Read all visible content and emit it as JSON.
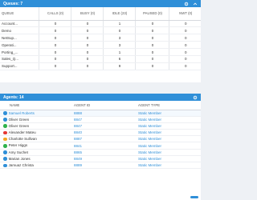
{
  "queues": {
    "title": "Queues: 7",
    "columns": [
      "QUEUE",
      "CALLS (0)",
      "BUSY (0)",
      "IDLE (23)",
      "PAUSED (0)",
      "NWT (0)"
    ],
    "rows": [
      {
        "name": "Account...",
        "calls": "0",
        "busy": "0",
        "idle": "1",
        "paused": "0",
        "nwt": "0"
      },
      {
        "name": "Demo",
        "calls": "0",
        "busy": "0",
        "idle": "0",
        "paused": "0",
        "nwt": "0"
      },
      {
        "name": "NetSup...",
        "calls": "0",
        "busy": "0",
        "idle": "3",
        "paused": "0",
        "nwt": "0"
      },
      {
        "name": "Operati...",
        "calls": "0",
        "busy": "0",
        "idle": "3",
        "paused": "0",
        "nwt": "0"
      },
      {
        "name": "Porting_...",
        "calls": "0",
        "busy": "0",
        "idle": "1",
        "paused": "0",
        "nwt": "0"
      },
      {
        "name": "Sales_Q...",
        "calls": "0",
        "busy": "0",
        "idle": "6",
        "paused": "0",
        "nwt": "0"
      },
      {
        "name": "Support...",
        "calls": "0",
        "busy": "0",
        "idle": "9",
        "paused": "0",
        "nwt": "0"
      }
    ]
  },
  "agents": {
    "title": "Agents: 14",
    "columns": [
      "NAME",
      "AGENT ID",
      "AGENT TYPE"
    ],
    "rows": [
      {
        "name": "Samuel Roberts",
        "id": "8888",
        "type": "Static Member",
        "color": "#2f8fd8",
        "selected": true
      },
      {
        "name": "Oliver Green",
        "id": "8847",
        "type": "Static Member",
        "color": "#2f8fd8"
      },
      {
        "name": "Oliver Green",
        "id": "8847",
        "type": "Static Member",
        "color": "#2fb24c"
      },
      {
        "name": "Alexander Mateu",
        "id": "8840",
        "type": "Static Member",
        "color": "#e53935"
      },
      {
        "name": "Charlotte Sullivan",
        "id": "8887",
        "type": "Static Member",
        "color": "#f5a623"
      },
      {
        "name": "Peter Higgs",
        "id": "8841",
        "type": "Static Member",
        "color": "#2fb24c"
      },
      {
        "name": "Amy Suchet",
        "id": "8865",
        "type": "Static Member",
        "color": "#2f8fd8"
      },
      {
        "name": "Marian Jones",
        "id": "8849",
        "type": "Static Member",
        "color": "#2f8fd8"
      },
      {
        "name": "Jamuaz Christa",
        "id": "8889",
        "type": "Static Member",
        "color": "#2f8fd8"
      }
    ]
  },
  "accent_color": "#2f8fd8"
}
